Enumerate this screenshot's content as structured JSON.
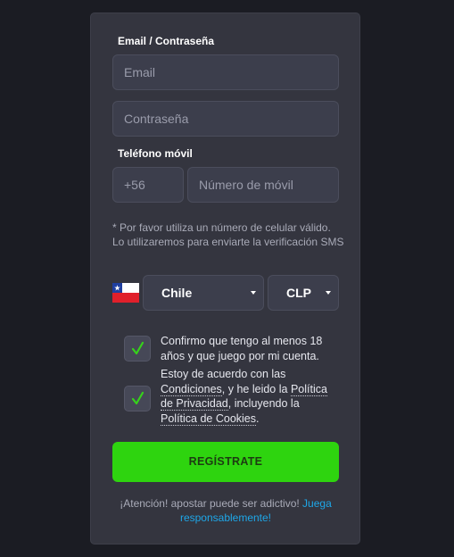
{
  "form": {
    "email_section_label": "Email / Contraseña",
    "email_placeholder": "Email",
    "password_placeholder": "Contraseña",
    "phone_section_label": "Teléfono móvil",
    "phone_prefix": "+56",
    "phone_placeholder": "Número de móvil",
    "phone_note": "* Por favor utiliza un número de celular válido. Lo utilizaremos para enviarte la verificación SMS",
    "country": "Chile",
    "currency": "CLP",
    "age_confirm": "Confirmo que tengo al menos 18 años y que juego por mi cuenta.",
    "terms": {
      "part1": "Estoy de acuerdo con las ",
      "conditions_link": "Condiciones",
      "part2": ", y he leido la ",
      "privacy_link": "Política de Privacidad",
      "part3": ", incluyendo la ",
      "cookies_link": "Política de Cookies",
      "part4": "."
    },
    "register_button": "REGÍSTRATE",
    "warning_text": "¡Atención! apostar puede ser adictivo! ",
    "warning_link": "Juega responsablemente!"
  },
  "icons": {
    "flag": "chile-flag-icon",
    "caret": "chevron-down-icon",
    "check": "checkmark-icon"
  },
  "colors": {
    "background": "#1b1c23",
    "card": "#34353f",
    "field": "#3c3e4c",
    "accent_green": "#2ed40f",
    "check_green": "#36d21b",
    "link_blue": "#1ea7e8"
  }
}
